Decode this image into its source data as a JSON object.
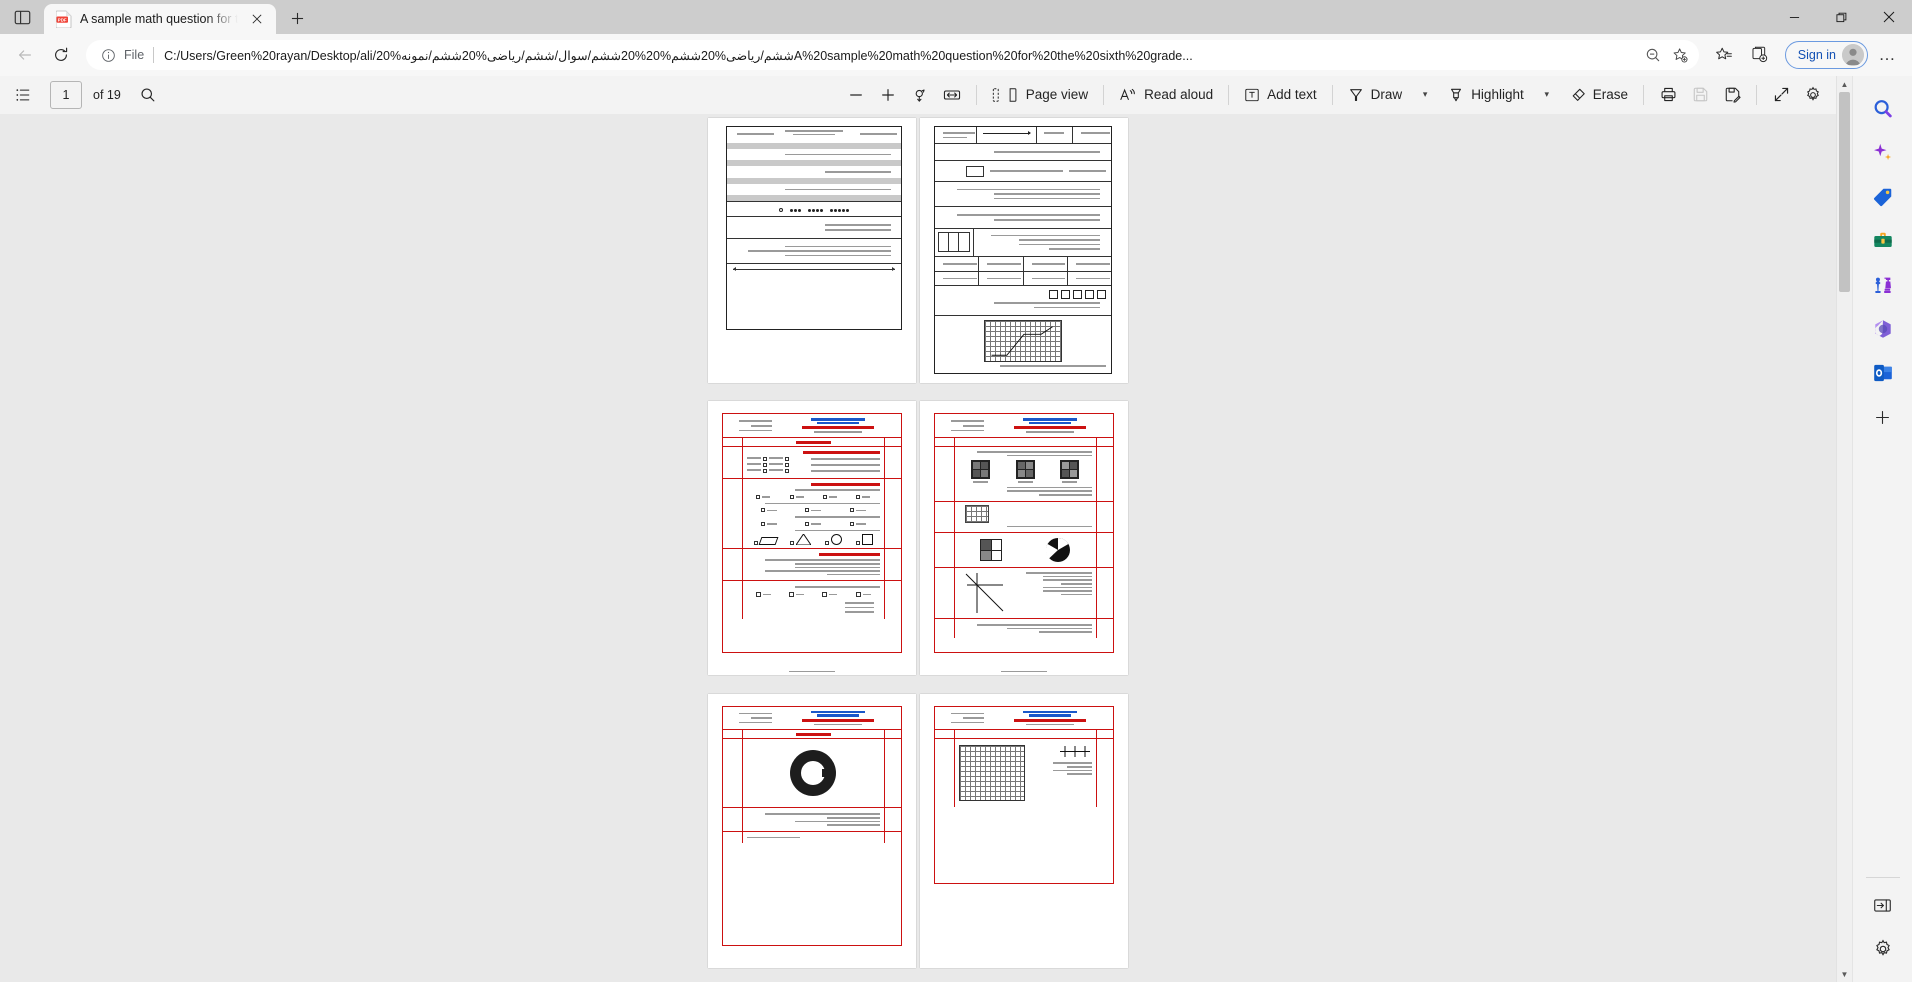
{
  "window": {
    "controls": [
      {
        "name": "minimize",
        "glyph": "—"
      },
      {
        "name": "restore",
        "glyph": "❐"
      },
      {
        "name": "close",
        "glyph": "✕"
      }
    ]
  },
  "tabbar": {
    "tab_search_icon": "tab-list-icon",
    "tabs": [
      {
        "title": "A sample math question for the s",
        "favicon": "pdf-icon",
        "active": true
      }
    ],
    "close_label": "✕",
    "newtab_label": "+"
  },
  "navbar": {
    "back_label": "←",
    "forward_label": "→",
    "reload_label": "⟳",
    "info_icon": "info-circle-icon",
    "scheme_label": "File",
    "url": "C:/Users/Green%20rayan/Desktop/ali/ششم/ریاضی%20ششم%20%20ششم/سوال/ششم/ریاضی%20ششم/نمونه%20A%20sample%20math%20question%20for%20the%20sixth%20grade...",
    "zoom_out_icon": "zoom-out-icon",
    "add_favorite_icon": "add-favorite-icon",
    "favorites_icon": "favorites-icon",
    "collections_icon": "collections-icon",
    "signin_label": "Sign in",
    "profile_icon": "avatar-icon",
    "settings_more_label": "…"
  },
  "pdf_toolbar": {
    "thumbnails_label": "page-list-icon",
    "page_number": "1",
    "page_total": "of 19",
    "search_icon": "search-icon",
    "zoom_out_label": "−",
    "zoom_in_label": "+",
    "rotate_icon": "rotate-icon",
    "fit_width_icon": "fit-width-icon",
    "page_view_icon": "page-view-icon",
    "page_view_label": "Page view",
    "read_aloud_icon": "read-aloud-icon",
    "read_aloud_label": "Read aloud",
    "add_text_icon": "add-text-icon",
    "add_text_label": "Add text",
    "draw_icon": "draw-icon",
    "draw_label": "Draw",
    "draw_chevron": "▾",
    "highlight_icon": "highlight-icon",
    "highlight_label": "Highlight",
    "highlight_chevron": "▾",
    "erase_icon": "erase-icon",
    "erase_label": "Erase",
    "print_icon": "print-icon",
    "save_icon": "save-icon",
    "save_as_icon": "save-as-icon",
    "fullscreen_icon": "fullscreen-icon",
    "settings_icon": "gear-icon"
  },
  "document": {
    "page_layout": "two-column",
    "pages": [
      {
        "index": 1,
        "type": "exam-sheet-plain"
      },
      {
        "index": 2,
        "type": "exam-sheet-plain"
      },
      {
        "index": 3,
        "type": "exam-sheet-red"
      },
      {
        "index": 4,
        "type": "exam-sheet-red"
      },
      {
        "index": 5,
        "type": "exam-sheet-red"
      },
      {
        "index": 6,
        "type": "exam-sheet-red"
      }
    ]
  },
  "scrollbar": {
    "up_arrow": "▲",
    "down_arrow": "▼",
    "position_percent": 8
  },
  "edgebar": {
    "items": [
      {
        "name": "search-icon",
        "label": "Search"
      },
      {
        "name": "copilot-icon",
        "label": "Copilot"
      },
      {
        "name": "shopping-icon",
        "label": "Shopping"
      },
      {
        "name": "tools-icon",
        "label": "Tools"
      },
      {
        "name": "games-icon",
        "label": "Games"
      },
      {
        "name": "microsoft365-icon",
        "label": "Microsoft 365"
      },
      {
        "name": "outlook-icon",
        "label": "Outlook"
      },
      {
        "name": "add-icon",
        "label": "Customize"
      }
    ],
    "bottom_items": [
      {
        "name": "show-sidebar-icon",
        "label": "Show sidebar"
      },
      {
        "name": "sidebar-settings-icon",
        "label": "Sidebar settings"
      }
    ]
  },
  "colors": {
    "accent": "#1351b4",
    "tab_bg": "#f7f7f7",
    "titlebar_bg": "#cdcdcd",
    "toolbar_bg": "#f3f3f3",
    "canvas_bg": "#e9e9e9",
    "pdf_red": "#cc1111"
  }
}
